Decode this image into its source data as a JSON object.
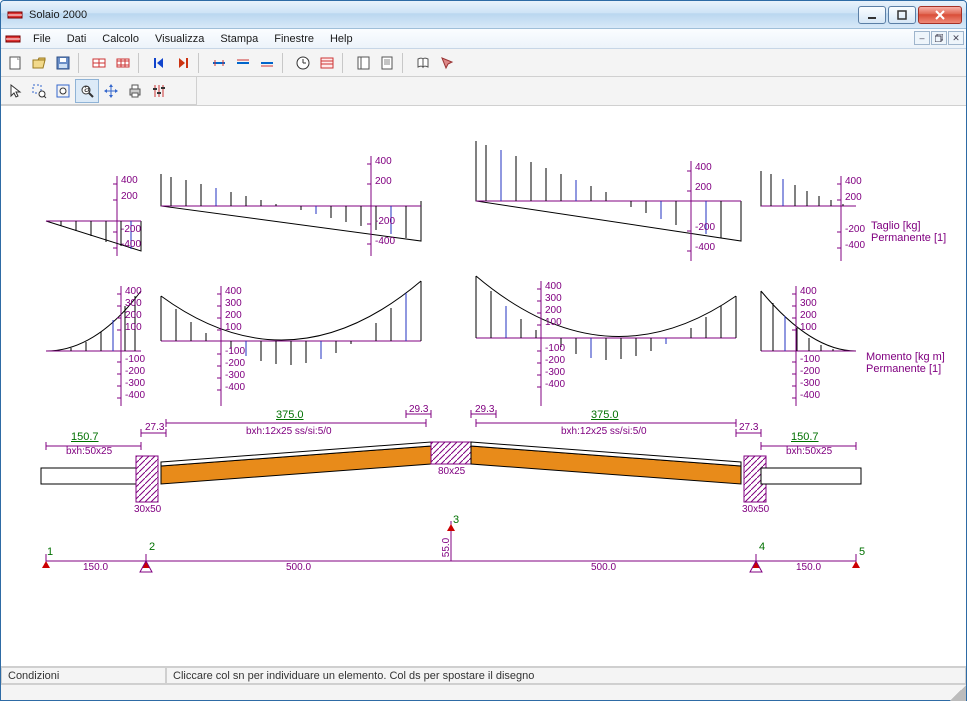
{
  "window": {
    "title": "Solaio 2000"
  },
  "menu": {
    "items": [
      "File",
      "Dati",
      "Calcolo",
      "Visualizza",
      "Stampa",
      "Finestre",
      "Help"
    ]
  },
  "toolbar1": {
    "icons": [
      "new",
      "open",
      "save",
      "grid1",
      "grid2",
      "nav-first",
      "nav-last",
      "beam1",
      "beam2",
      "beam3",
      "clock",
      "table",
      "doc",
      "page",
      "book",
      "help"
    ]
  },
  "toolbar2": {
    "icons": [
      "pointer",
      "zoom-window",
      "zoom-extents",
      "zoom-realtime",
      "pan",
      "print",
      "settings"
    ],
    "active_index": 3
  },
  "status": {
    "left": "Condizioni",
    "right": "Cliccare col sn per individuare un elemento. Col ds per spostare il disegno"
  },
  "diagram": {
    "axis_ticks_shear": [
      "400",
      "200",
      "-200",
      "-400"
    ],
    "axis_ticks_moment": [
      "400",
      "300",
      "200",
      "100",
      "-100",
      "-200",
      "-300",
      "-400"
    ],
    "label_shear": "Taglio [kg]\nPermanente [1]",
    "label_moment": "Momento [kg m]\nPermanente [1]",
    "span_left_cant": "150.7",
    "span_left_cant_sub": "bxh:50x25",
    "span_main": "375.0",
    "span_main_sub": "bxh:12x25  ss/si:5/0",
    "gap_left": "27.3",
    "gap_center_l": "29.3",
    "gap_center_r": "29.3",
    "gap_right": "27.3",
    "span_right_cant": "150.7",
    "span_right_cant_sub": "bxh:50x25",
    "support_label": "30x50",
    "center_label": "80x25",
    "axis_nodes": [
      "1",
      "2",
      "3",
      "4",
      "5"
    ],
    "axis_dims": [
      "150.0",
      "500.0",
      "500.0",
      "150.0"
    ],
    "axis_center_h": "55.0"
  },
  "chart_data": [
    {
      "type": "line",
      "title": "Taglio [kg] — Permanente [1]",
      "ylabel": "Taglio [kg]",
      "ylim": [
        -400,
        400
      ],
      "yticks": [
        400,
        200,
        0,
        -200,
        -400
      ],
      "segments": [
        {
          "name": "sbalzo-sx",
          "x": [
            0,
            150
          ],
          "values": [
            0,
            -350
          ]
        },
        {
          "name": "campata-sx",
          "x": [
            150,
            650
          ],
          "values": [
            380,
            -420
          ]
        },
        {
          "name": "campata-dx",
          "x": [
            650,
            1150
          ],
          "values": [
            420,
            -380
          ]
        },
        {
          "name": "sbalzo-dx",
          "x": [
            1150,
            1300
          ],
          "values": [
            350,
            0
          ]
        }
      ]
    },
    {
      "type": "line",
      "title": "Momento [kg m] — Permanente [1]",
      "ylabel": "Momento [kg m]",
      "ylim": [
        -400,
        400
      ],
      "yticks": [
        400,
        300,
        200,
        100,
        0,
        -100,
        -200,
        -300,
        -400
      ],
      "segments": [
        {
          "name": "sbalzo-sx",
          "x": [
            0,
            150
          ],
          "values": [
            0,
            350
          ]
        },
        {
          "name": "campata-sx",
          "x": [
            150,
            400,
            650
          ],
          "values": [
            350,
            -200,
            400
          ]
        },
        {
          "name": "campata-dx",
          "x": [
            650,
            900,
            1150
          ],
          "values": [
            400,
            -200,
            350
          ]
        },
        {
          "name": "sbalzo-dx",
          "x": [
            1150,
            1300
          ],
          "values": [
            350,
            0
          ]
        }
      ]
    }
  ]
}
